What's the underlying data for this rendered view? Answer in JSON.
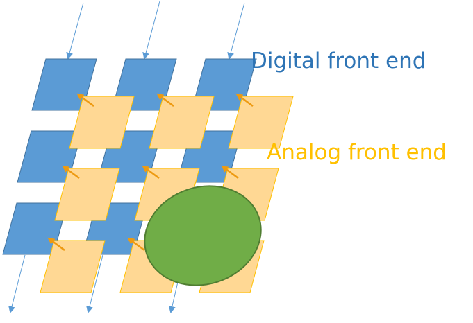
{
  "labels": {
    "digital": "Digital front end",
    "analog": "Analog front end"
  },
  "colors": {
    "digital_fill": "#5b9bd5",
    "digital_stroke": "#41719c",
    "digital_text": "#2e74b5",
    "analog_fill": "#ffd894",
    "analog_stroke": "#ffc000",
    "analog_text": "#ffc000",
    "arrow_orange": "#ed9a12",
    "arrow_blue": "#5b9bd5",
    "ellipse_fill": "#70ad47",
    "ellipse_stroke": "#507e32"
  }
}
